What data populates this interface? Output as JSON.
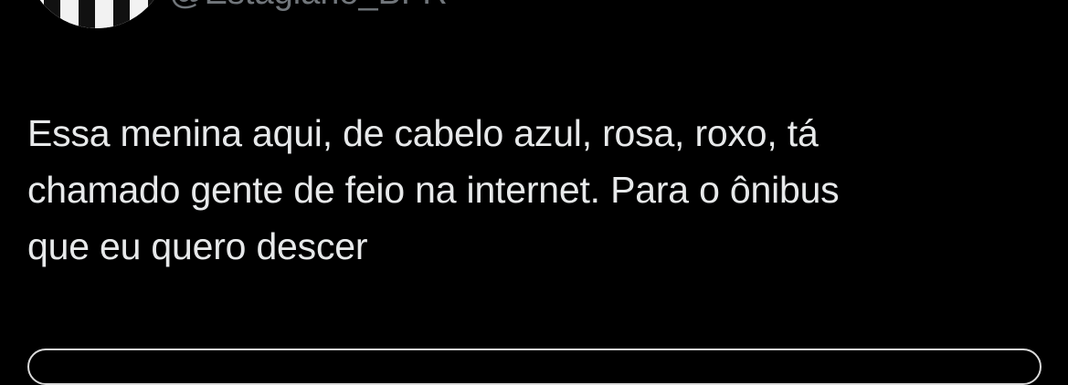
{
  "tweet": {
    "handle": "@Estagiario_BFR",
    "text": "Essa menina aqui, de cabelo azul, rosa, roxo, tá\nchamado gente de feio na internet. Para o ônibus\nque eu quero descer"
  },
  "colors": {
    "background": "#000000",
    "text": "#e7e9ea",
    "secondary_text": "#71767b"
  }
}
